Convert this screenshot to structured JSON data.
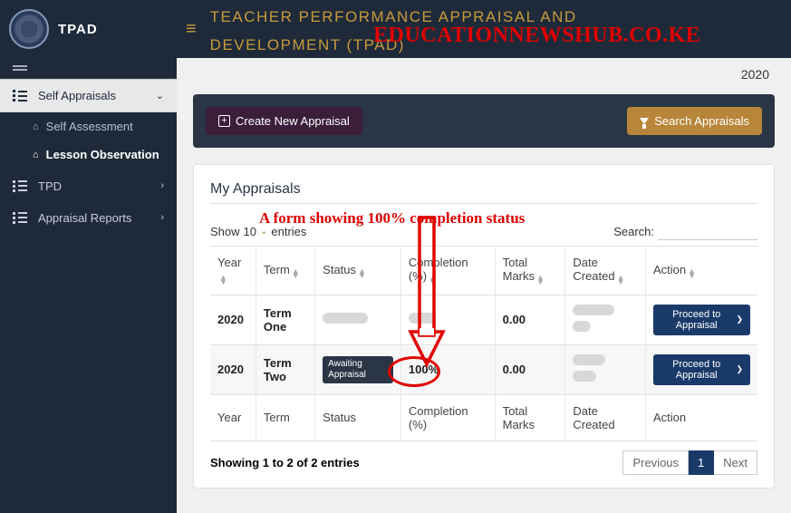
{
  "brand": "TPAD",
  "header_title_line1": "TEACHER PERFORMANCE APPRAISAL AND",
  "header_title_line2": "DEVELOPMENT (TPAD)",
  "watermark": "EDUCATIONNEWSHUB.CO.KE",
  "year_display": "2020",
  "sidebar": {
    "self_appraisals": "Self Appraisals",
    "self_assessment": "Self Assessment",
    "lesson_observation": "Lesson Observation",
    "tpd": "TPD",
    "appraisal_reports": "Appraisal Reports"
  },
  "actions": {
    "create": "Create New Appraisal",
    "search": "Search Appraisals"
  },
  "panel": {
    "title": "My Appraisals",
    "show_label": "Show",
    "show_count": "10",
    "entries_label": "entries",
    "search_label": "Search:",
    "annotation": "A form showing 100% completion status"
  },
  "columns": {
    "year": "Year",
    "term": "Term",
    "status": "Status",
    "completion": "Completion (%)",
    "total_marks": "Total Marks",
    "date_created": "Date Created",
    "action": "Action"
  },
  "rows": [
    {
      "year": "2020",
      "term": "Term One",
      "status": "",
      "completion": "",
      "total_marks": "0.00",
      "date_created": "",
      "action_label": "Proceed to Appraisal"
    },
    {
      "year": "2020",
      "term": "Term Two",
      "status": "Awaiting Appraisal",
      "completion": "100%",
      "total_marks": "0.00",
      "date_created": "",
      "action_label": "Proceed to Appraisal"
    }
  ],
  "footer_columns": {
    "year": "Year",
    "term": "Term",
    "status": "Status",
    "completion": "Completion (%)",
    "total_marks": "Total Marks",
    "date_created": "Date Created",
    "action": "Action"
  },
  "table_footer": {
    "info": "Showing 1 to 2 of 2 entries",
    "prev": "Previous",
    "page": "1",
    "next": "Next"
  }
}
